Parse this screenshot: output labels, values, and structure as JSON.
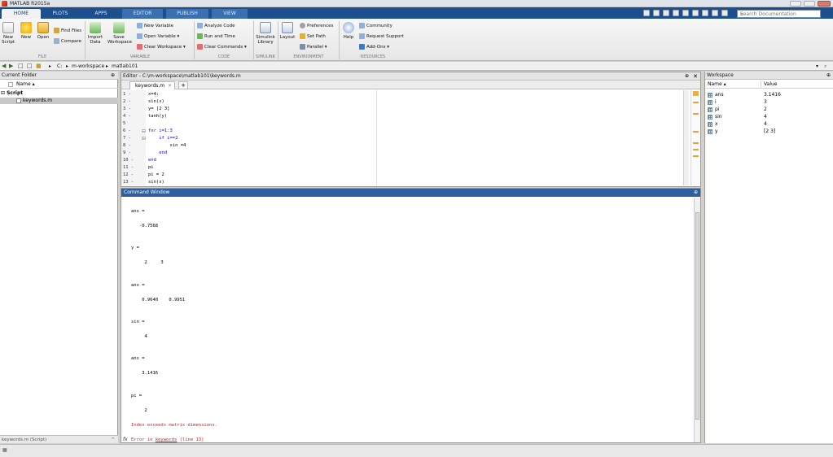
{
  "window": {
    "title": "MATLAB R2015a"
  },
  "tabs": [
    "HOME",
    "PLOTS",
    "APPS",
    "EDITOR",
    "PUBLISH",
    "VIEW"
  ],
  "search": {
    "placeholder": "Search Documentation"
  },
  "ribbon": {
    "new_script": "New Script",
    "new": "New",
    "open": "Open",
    "find_files": "Find Files",
    "compare": "Compare",
    "import_data": "Import Data",
    "save_workspace": "Save Workspace",
    "new_variable": "New Variable",
    "open_variable": "Open Variable",
    "clear_workspace": "Clear Workspace",
    "analyze_code": "Analyze Code",
    "run_and_time": "Run and Time",
    "clear_commands": "Clear Commands",
    "simulink_library": "Simulink Library",
    "layout": "Layout",
    "preferences": "Preferences",
    "set_path": "Set Path",
    "parallel": "Parallel",
    "help": "Help",
    "community": "Community",
    "request_support": "Request Support",
    "add_ons": "Add-Ons",
    "groups": {
      "file": "FILE",
      "variable": "VARIABLE",
      "code": "CODE",
      "simulink": "SIMULINK",
      "environment": "ENVIRONMENT",
      "resources": "RESOURCES"
    }
  },
  "address": {
    "parts": [
      "C:",
      "m-workspace",
      "matlab101"
    ]
  },
  "current_folder": {
    "title": "Current Folder",
    "column_name": "Name",
    "group": "Script",
    "file": "keywords.m",
    "footer": "keywords.m (Script)"
  },
  "editor": {
    "title": "Editor - C:\\m-workspace\\matlab101\\keywords.m",
    "tab": "keywords.m",
    "line_numbers": [
      "1 -",
      "2 -",
      "3 -",
      "4 -",
      "5",
      "6 -",
      "7 -",
      "8 -",
      "9 -",
      "10 -",
      "11 -",
      "12 -",
      "13 -"
    ],
    "lines": [
      "x=4;",
      "sin(x)",
      "y= [2 3]",
      "tanh(y)",
      "",
      "for i=1:3",
      "    if i==2",
      "        sin =4",
      "    end",
      "end",
      "pi",
      "pi = 2",
      "sin(x)"
    ]
  },
  "command_window": {
    "title": "Command Window",
    "lines": [
      "ans =",
      "   -0.7568",
      "y =",
      "     2     3",
      "ans =",
      "    0.9640    0.9951",
      "sin =",
      "     4",
      "ans =",
      "    3.1416",
      "pi =",
      "     2"
    ],
    "error_line1": "Index exceeds matrix dimensions.",
    "error_prefix": "Error in ",
    "error_link": "keywords",
    "error_suffix": " (line 13)",
    "fx": "fx"
  },
  "workspace": {
    "title": "Workspace",
    "col_name": "Name",
    "col_value": "Value",
    "vars": [
      {
        "name": "ans",
        "value": "3.1416"
      },
      {
        "name": "i",
        "value": "3"
      },
      {
        "name": "pi",
        "value": "2"
      },
      {
        "name": "sin",
        "value": "4"
      },
      {
        "name": "x",
        "value": "4"
      },
      {
        "name": "y",
        "value": "[2 3]"
      }
    ]
  },
  "colors": {
    "ribbon_tab_bg": "#1c4f8c",
    "command_title": "#2f5f9e",
    "error": "#d02020",
    "keyword": "#0000ff"
  }
}
